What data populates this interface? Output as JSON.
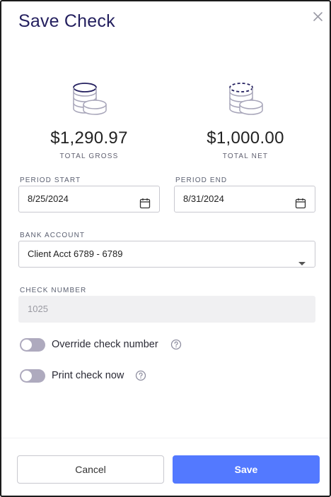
{
  "dialog": {
    "title": "Save Check"
  },
  "totals": {
    "gross": {
      "amount": "$1,290.97",
      "label": "TOTAL GROSS"
    },
    "net": {
      "amount": "$1,000.00",
      "label": "TOTAL NET"
    }
  },
  "period_start": {
    "label": "PERIOD START",
    "value": "8/25/2024"
  },
  "period_end": {
    "label": "PERIOD END",
    "value": "8/31/2024"
  },
  "bank_account": {
    "label": "BANK ACCOUNT",
    "value": "Client Acct 6789 - 6789"
  },
  "check_number": {
    "label": "CHECK NUMBER",
    "value": "1025"
  },
  "toggles": {
    "override": {
      "label": "Override check number",
      "on": false
    },
    "print": {
      "label": "Print check now",
      "on": false
    }
  },
  "footer": {
    "cancel_label": "Cancel",
    "save_label": "Save"
  },
  "colors": {
    "title": "#24205f",
    "primary": "#5379ff",
    "toggle_off": "#aeaabe"
  },
  "icons": [
    "close-icon",
    "coins-icon",
    "coins-dashed-icon",
    "calendar-icon",
    "chevron-down-icon",
    "help-icon"
  ]
}
